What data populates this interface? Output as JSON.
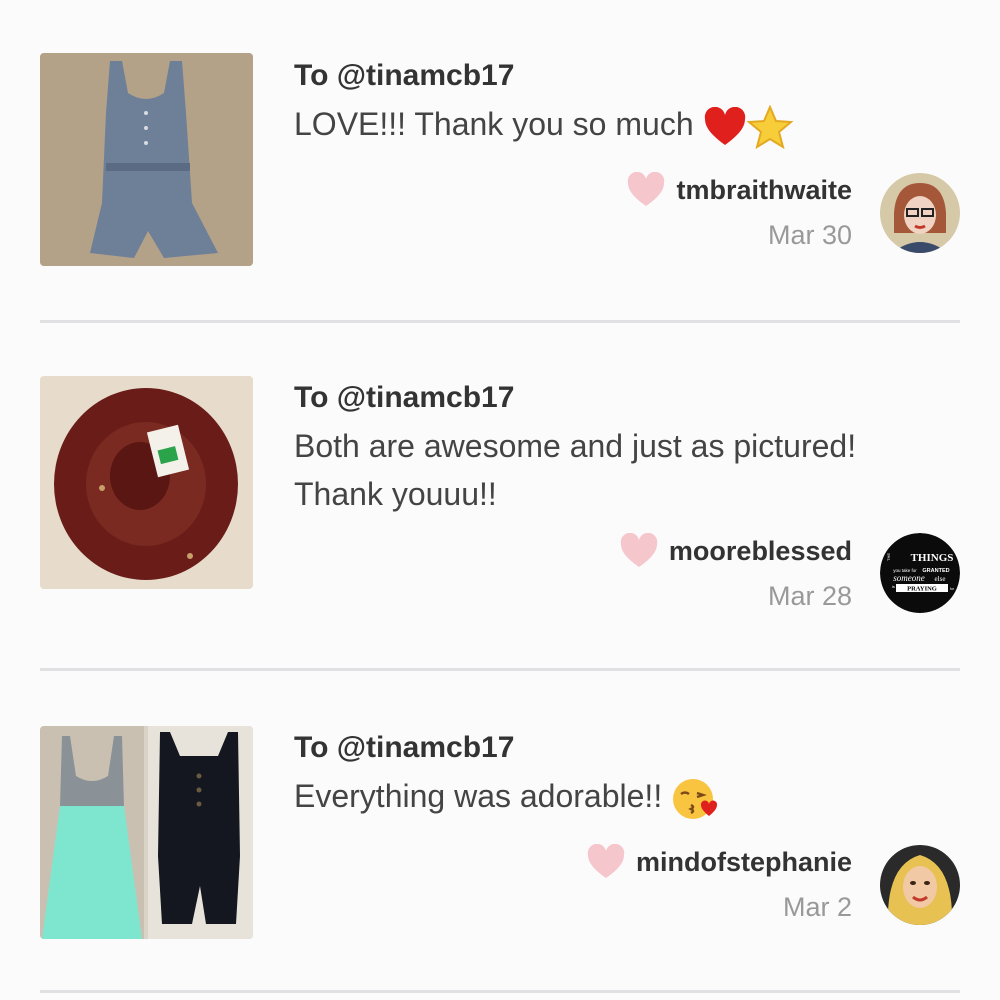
{
  "reviews": [
    {
      "to": "To @tinamcb17",
      "message": "LOVE!!! Thank you so much",
      "emojis": [
        "red-heart-icon",
        "star-icon"
      ],
      "username": "tmbraithwaite",
      "date": "Mar 30"
    },
    {
      "to": "To @tinamcb17",
      "message_line1": "Both are awesome and just as pictured!",
      "message_line2": "Thank youuu!!",
      "username": "mooreblessed",
      "date": "Mar 28",
      "avatar_text": {
        "t": "THINGS",
        "l2a": "you take for",
        "l2b": "GRANTED",
        "l3a": "someone",
        "l3b": "else",
        "l4": "PRAYING",
        "left_the": "THE",
        "left_is": "is",
        "right_for": "for"
      }
    },
    {
      "to": "To @tinamcb17",
      "message": "Everything was adorable!!",
      "emojis": [
        "kissing-face-icon"
      ],
      "username": "mindofstephanie",
      "date": "Mar 2"
    }
  ],
  "colors": {
    "background": "#fbfbfc",
    "divider": "#e1e1e3",
    "like_heart": "#f5c6cc"
  }
}
